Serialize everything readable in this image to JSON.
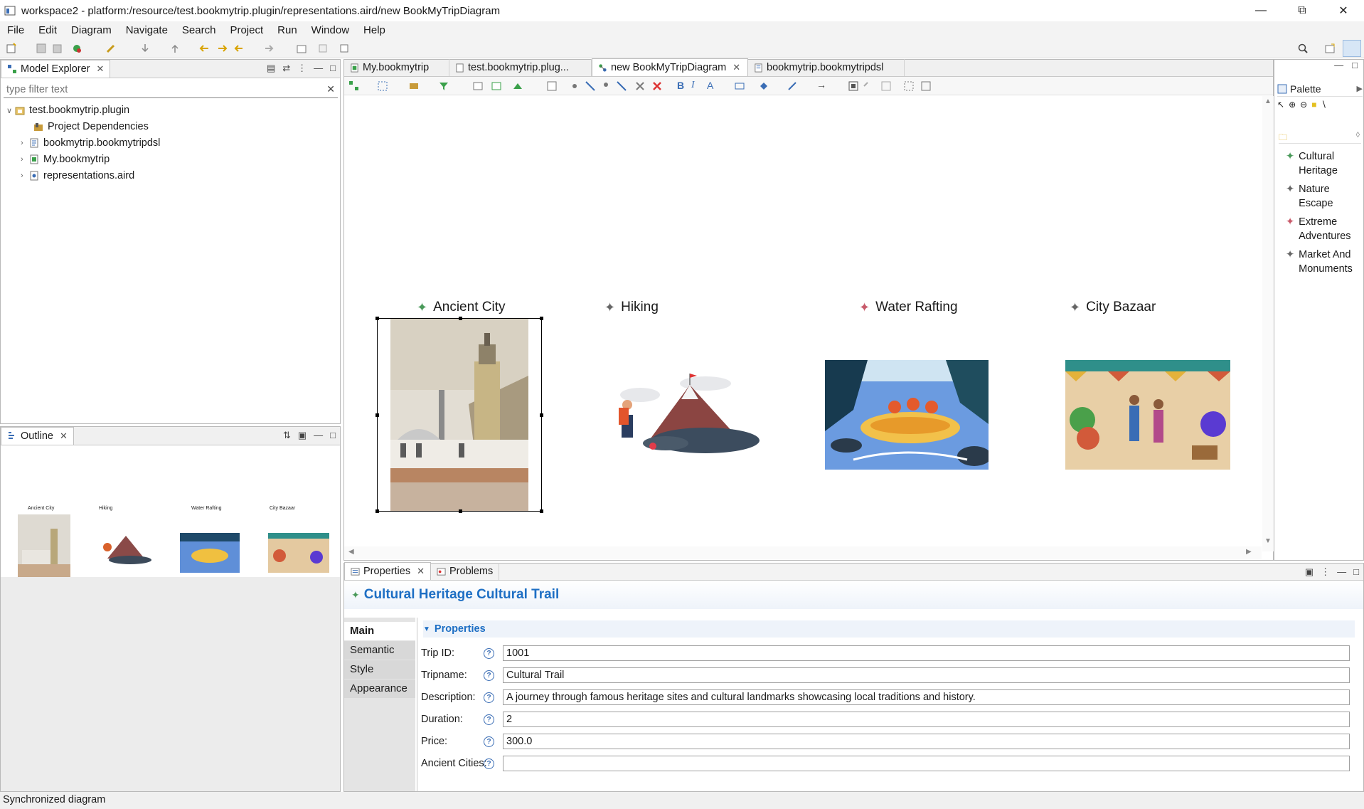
{
  "window": {
    "title": "workspace2 - platform:/resource/test.bookmytrip.plugin/representations.aird/new BookMyTripDiagram"
  },
  "menu": [
    "File",
    "Edit",
    "Diagram",
    "Navigate",
    "Search",
    "Project",
    "Run",
    "Window",
    "Help"
  ],
  "model_explorer": {
    "tab": "Model Explorer",
    "filter_placeholder": "type filter text",
    "tree": [
      {
        "label": "test.bookmytrip.plugin",
        "expanded": true,
        "icon": "project-icon"
      },
      {
        "label": "Project Dependencies",
        "icon": "library-icon"
      },
      {
        "label": "bookmytrip.bookmytripdsl",
        "icon": "file-icon"
      },
      {
        "label": "My.bookmytrip",
        "icon": "model-file-icon"
      },
      {
        "label": "representations.aird",
        "icon": "aird-file-icon"
      }
    ]
  },
  "outline": {
    "tab": "Outline",
    "labels": [
      "Ancient City",
      "Hiking",
      "Water Rafting",
      "City Bazaar"
    ]
  },
  "editor_tabs": [
    "My.bookmytrip",
    "test.bookmytrip.plug...",
    "new BookMyTripDiagram",
    "bookmytrip.bookmytripdsl"
  ],
  "diagram": {
    "nodes": [
      {
        "label": "Ancient City",
        "selected": true,
        "star_color": "#4a9a5a"
      },
      {
        "label": "Hiking",
        "selected": false,
        "star_color": "#666666"
      },
      {
        "label": "Water Rafting",
        "selected": false,
        "star_color": "#c85a6a"
      },
      {
        "label": "City Bazaar",
        "selected": false,
        "star_color": "#666666"
      }
    ]
  },
  "palette": {
    "title": "Palette",
    "items": [
      {
        "line1": "Cultural",
        "line2": "Heritage",
        "color": "#4a9a5a"
      },
      {
        "line1": "Nature",
        "line2": "Escape",
        "color": "#666666"
      },
      {
        "line1": "Extreme",
        "line2": "Adventures",
        "color": "#c85a6a"
      },
      {
        "line1": "Market And",
        "line2": "Monuments",
        "color": "#666666"
      }
    ]
  },
  "properties": {
    "tabs": [
      "Properties",
      "Problems"
    ],
    "heading": "Cultural Heritage Cultural Trail",
    "section": "Properties",
    "side_tabs": [
      "Main",
      "Semantic",
      "Style",
      "Appearance"
    ],
    "fields": [
      {
        "label": "Trip ID:",
        "value": "1001"
      },
      {
        "label": "Tripname:",
        "value": "Cultural Trail"
      },
      {
        "label": "Description:",
        "value": "A journey through famous heritage sites and cultural landmarks showcasing local traditions and history."
      },
      {
        "label": "Duration:",
        "value": "2"
      },
      {
        "label": "Price:",
        "value": "300.0"
      },
      {
        "label": "Ancient Cities:",
        "value": ""
      }
    ]
  },
  "status": "Synchronized diagram",
  "colors": {
    "accent": "#1e6fc4",
    "selection": "#000000"
  }
}
